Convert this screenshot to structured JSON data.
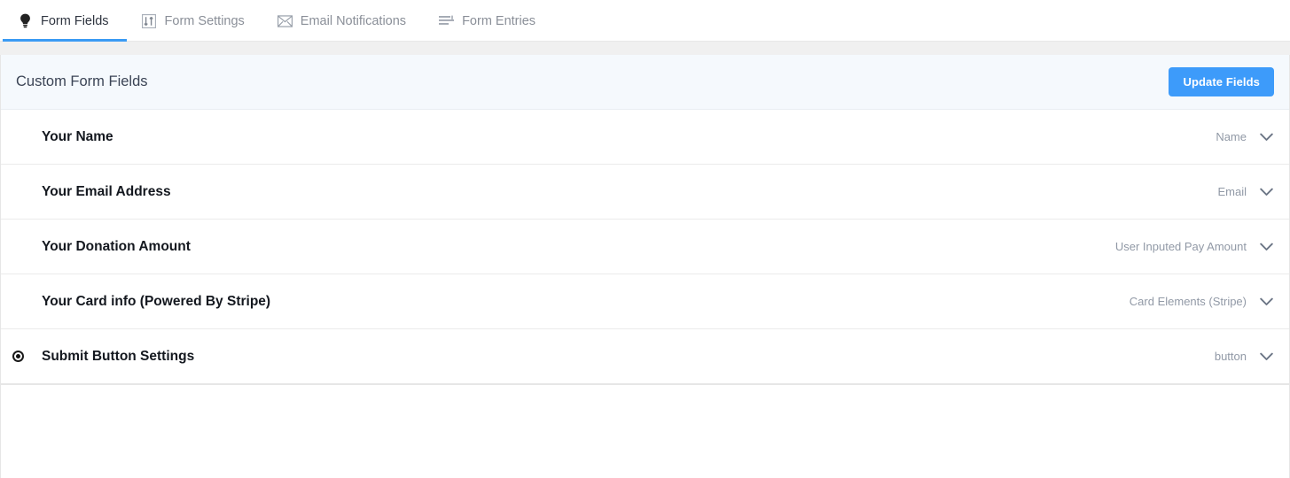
{
  "tabs": [
    {
      "label": "Form Fields",
      "icon": "lightbulb-icon",
      "active": true
    },
    {
      "label": "Form Settings",
      "icon": "sliders-icon",
      "active": false
    },
    {
      "label": "Email Notifications",
      "icon": "envelope-icon",
      "active": false
    },
    {
      "label": "Form Entries",
      "icon": "list-lines-icon",
      "active": false
    }
  ],
  "panel": {
    "title": "Custom Form Fields",
    "update_button_label": "Update Fields"
  },
  "fields": [
    {
      "label": "Your Name",
      "type": "Name",
      "handle": "drag-handle-icon",
      "toggle": "chevron-down-icon"
    },
    {
      "label": "Your Email Address",
      "type": "Email",
      "handle": "drag-handle-icon",
      "toggle": "chevron-down-icon"
    },
    {
      "label": "Your Donation Amount",
      "type": "User Inputed Pay Amount",
      "handle": "drag-handle-icon",
      "toggle": "chevron-down-icon"
    },
    {
      "label": "Your Card info (Powered By Stripe)",
      "type": "Card Elements (Stripe)",
      "handle": "drag-handle-icon",
      "toggle": "chevron-down-icon"
    },
    {
      "label": "Submit Button Settings",
      "type": "button",
      "handle": "radio-dot-icon",
      "toggle": "chevron-down-icon"
    }
  ],
  "colors": {
    "accent_blue": "#3d9bfa",
    "active_tab_underline": "#3a9bf4",
    "header_bg": "#f5f9fd",
    "gap_strip": "#f0f0f0",
    "muted_text": "#9199a6"
  }
}
